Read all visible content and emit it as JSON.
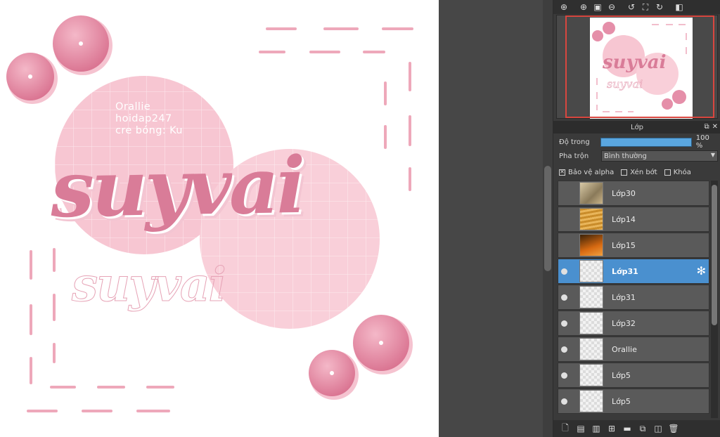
{
  "canvas": {
    "credit_lines": [
      "Orallie",
      "hoidap247",
      "cre bóng: Ku"
    ],
    "main_text": "suyvai",
    "outline_text": "suyvai"
  },
  "toolbar": {
    "icons": [
      "zoom-fit-icon",
      "zoom-in-icon",
      "fit-window-icon",
      "zoom-out-icon",
      "rotate-left-icon",
      "fullscreen-icon",
      "rotate-right-icon",
      "flip-icon"
    ]
  },
  "layers_panel": {
    "title": "Lớp",
    "opacity_label": "Độ trong",
    "opacity_value": "100 %",
    "opacity_fraction": 1.0,
    "blend_label": "Pha trộn",
    "blend_value": "Bình thường",
    "protect_alpha_label": "Bảo vệ alpha",
    "protect_alpha_checked": true,
    "clipping_label": "Xén bớt",
    "clipping_checked": false,
    "lock_label": "Khóa",
    "lock_checked": false,
    "layers": [
      {
        "name": "Lớp30",
        "visible": false,
        "thumb": "photo1",
        "selected": false
      },
      {
        "name": "Lớp14",
        "visible": false,
        "thumb": "photo2",
        "selected": false
      },
      {
        "name": "Lớp15",
        "visible": false,
        "thumb": "photo3",
        "selected": false
      },
      {
        "name": "Lớp31",
        "visible": true,
        "thumb": "art",
        "selected": true
      },
      {
        "name": "Lớp31",
        "visible": true,
        "thumb": "art",
        "selected": false
      },
      {
        "name": "Lớp32",
        "visible": true,
        "thumb": "empty",
        "selected": false
      },
      {
        "name": "Orallie",
        "visible": true,
        "thumb": "empty",
        "selected": false
      },
      {
        "name": "Lớp5",
        "visible": true,
        "thumb": "art",
        "selected": false
      },
      {
        "name": "Lớp5",
        "visible": true,
        "thumb": "art",
        "selected": false
      }
    ]
  },
  "colors": {
    "pink_circle": "#f7c6d2",
    "pink_flower": "#e58fa9",
    "selected_layer": "#4a90cf",
    "nav_frame": "#d8463f"
  }
}
